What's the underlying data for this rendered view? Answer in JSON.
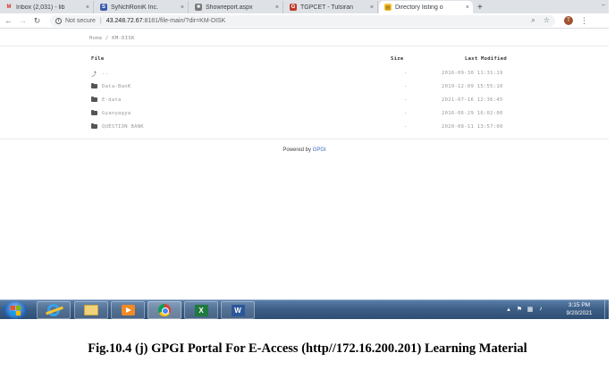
{
  "browser": {
    "tabs": [
      {
        "title": "Inbox (2,031) - lib",
        "icon": "gmail-icon",
        "active": false
      },
      {
        "title": "SyNchRoniK Inc.",
        "icon": "synchronik-icon",
        "active": false
      },
      {
        "title": "Showreport.aspx",
        "icon": "report-icon",
        "active": false
      },
      {
        "title": "TGPCET - Tulsiran",
        "icon": "tgpcet-icon",
        "active": false
      },
      {
        "title": "Directory listing o",
        "icon": "directory-icon",
        "active": true
      }
    ],
    "new_tab_label": "+",
    "tab_close_glyph": "×",
    "minimize_glyph": "–",
    "address": {
      "security_text": "Not secure",
      "url_host": "43.248.72.67",
      "url_rest": ":8181/file-main/?dir=KM-DISK"
    }
  },
  "page": {
    "breadcrumb": "Home / KM-DISK",
    "columns": {
      "name": "File",
      "size": "Size",
      "modified": "Last Modified"
    },
    "rows": [
      {
        "icon": "up-arrow-icon",
        "name": "..",
        "size": "-",
        "modified": "2016-09-30 11:31:19"
      },
      {
        "icon": "folder-icon",
        "name": "Data-BanK",
        "size": "-",
        "modified": "2019-12-09 15:55:10"
      },
      {
        "icon": "folder-icon",
        "name": "E-data",
        "size": "-",
        "modified": "2021-07-16 12:36:45"
      },
      {
        "icon": "folder-icon",
        "name": "Gyanyagya",
        "size": "-",
        "modified": "2016-06-29 16:02:00"
      },
      {
        "icon": "folder-icon",
        "name": "QUESTION BANK",
        "size": "-",
        "modified": "2020-08-11 13:57:00"
      }
    ],
    "footer_prefix": "Powered by",
    "footer_brand": "GPGI"
  },
  "taskbar": {
    "apps": [
      "internet-explorer-icon",
      "file-explorer-icon",
      "media-player-icon",
      "chrome-icon",
      "excel-icon",
      "word-icon"
    ],
    "excel_glyph": "X",
    "word_glyph": "W",
    "clock_time": "3:15 PM",
    "clock_date": "9/20/2021"
  },
  "caption": "Fig.10.4 (j) GPGI  Portal For E-Access (http//172.16.200.201) Learning Material",
  "colors": {
    "taskbar": "#3d5f87",
    "link": "#3b6bbf",
    "tab_strip": "#dee1e6"
  }
}
